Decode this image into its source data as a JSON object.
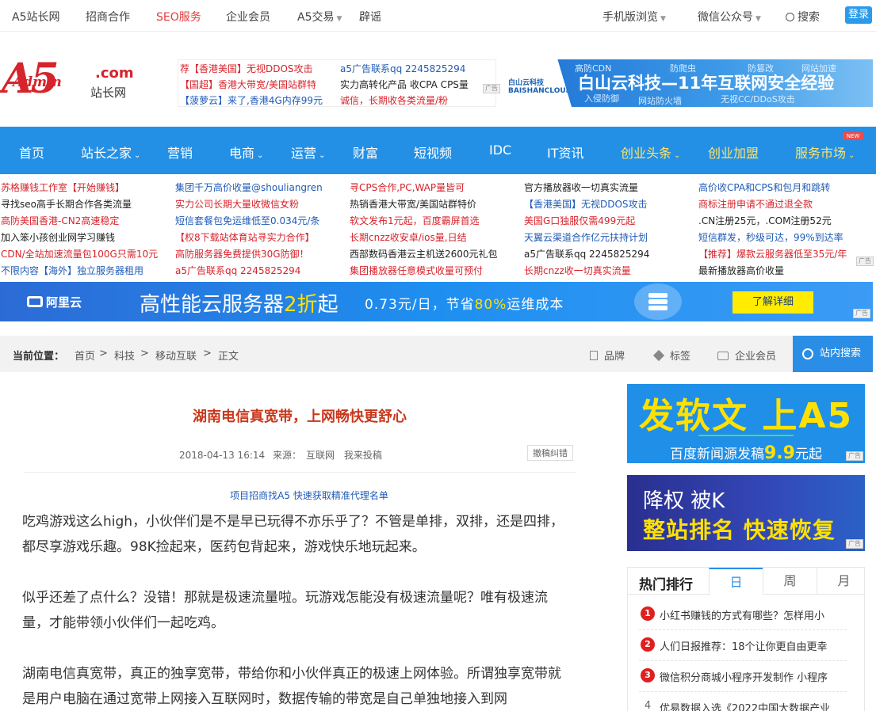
{
  "topbar": {
    "items": [
      "A5站长网",
      "招商合作",
      "SEO服务",
      "企业会员",
      "A5交易",
      "辟谣"
    ],
    "right": [
      "手机版浏览",
      "微信公众号",
      "搜索"
    ],
    "login": "登录"
  },
  "logo": {
    "mark": "A5",
    "sub": "Admin",
    "com": ".com",
    "site": "站长网"
  },
  "text_ads": [
    [
      "荐【香港美国】无视DDOS攻击",
      "a5广告联系qq 2245825294"
    ],
    [
      "【国超】香港大带宽/美国站群特",
      "实力高转化产品 收CPA CPS量"
    ],
    [
      "【菠萝云】来了,香港4G内存99元",
      "诚信，长期收各类流量/粉"
    ]
  ],
  "baishan": {
    "logo": "白山云科技 BAISHANCLOUD",
    "headline": "白山云科技—11年互联网安全经验",
    "tags": [
      "高防CDN",
      "防爬虫",
      "防篡改",
      "网站加速",
      "入侵防御",
      "网站防火墙",
      "无视CC/DDoS攻击"
    ]
  },
  "nav": {
    "items": [
      "首页",
      "站长之家",
      "营销",
      "电商",
      "运营",
      "财富",
      "短视频",
      "IDC",
      "IT资讯",
      "创业头条",
      "创业加盟",
      "服务市场"
    ],
    "badge": "NEW"
  },
  "links": {
    "col1": [
      "苏格赚钱工作室【开始赚钱】",
      "寻找seo高手长期合作各类流量",
      "高防美国香港-CN2高速稳定",
      "加入笨小孩创业网学习赚钱",
      "CDN/全站加速流量包100G只需10元",
      "不限内容【海外】独立服务器租用"
    ],
    "col2": [
      "集团千万高价收量@shouliangren",
      "实力公司长期大量收微信女粉",
      "短信套餐包免运维低至0.034元/条",
      "【权8下载站体育站寻实力合作】",
      "高防服务器免费提供30G防御！",
      "a5广告联系qq 2245825294"
    ],
    "col3": [
      "寻CPS合作,PC,WAP量皆可",
      "热销香港大带宽/美国站群特价",
      "软文发布1元起，百度霸屏首选",
      "长期cnzz收安卓/ios量,日结",
      "西部数码香港云主机送2600元礼包",
      "集团播放器任意模式收量可预付"
    ],
    "col4": [
      "官方播放器收一切真实流量",
      "【香港美国】无视DDOS攻击",
      "美国G口独服仅需499元起",
      "天翼云渠道合作亿元扶持计划",
      "a5广告联系qq 2245825294",
      "长期cnzz收一切真实流量"
    ],
    "col5": [
      "高价收CPA和CPS和包月和跳转",
      "商标注册申请不通过退全款",
      ".CN注册25元，.COM注册52元",
      "短信群发，秒级可达，99%到达率",
      "【推荐】爆款云服务器低至35元/年",
      "最新播放器高价收量"
    ]
  },
  "aliyun": {
    "brand": "阿里云",
    "headline_a": "高性能云服务器",
    "headline_b": "2折",
    "headline_c": "起",
    "sub_a": "0.73元/日，节省",
    "sub_b": "80%",
    "sub_c": "运维成本",
    "cta": "了解详细"
  },
  "breadcrumb": {
    "label": "当前位置：",
    "path": [
      "首页",
      ">",
      "科技",
      ">",
      "移动互联",
      ">",
      "正文"
    ],
    "tools": [
      "品牌",
      "标签",
      "企业会员"
    ],
    "search": "站内搜索"
  },
  "article": {
    "title": "湖南电信真宽带，上网畅快更舒心",
    "date": "2018-04-13 16:14",
    "source_label": "来源：",
    "source": "互联网",
    "submit": "我来投稿",
    "correction": "撤稿纠错",
    "promo": "项目招商找A5 快速获取精准代理名单",
    "paragraphs": [
      "吃鸡游戏这么high，小伙伴们是不是早已玩得不亦乐乎了？不管是单排，双排，还是四排，都尽享游戏乐趣。98K捡起来，医药包背起来，游戏快乐地玩起来。",
      "似乎还差了点什么？没错！那就是极速流量啦。玩游戏怎能没有极速流量呢？唯有极速流量，才能带领小伙伴们一起吃鸡。",
      "湖南电信真宽带，真正的独享宽带，带给你和小伙伴真正的极速上网体验。所谓独享宽带就是用户电脑在通过宽带上网接入互联网时，数据传输的带宽是自己单独地接入到网"
    ]
  },
  "side_ads": {
    "ad1_main": "发软文 上A5",
    "ad1_sub_a": "百度新闻源发稿",
    "ad1_sub_b": "9.9",
    "ad1_sub_c": "元起",
    "ad2_l1": "降权 被K",
    "ad2_l2": "整站排名 快速恢复",
    "ad_tag": "广告"
  },
  "hot": {
    "title": "热门排行",
    "tabs": [
      "日",
      "周",
      "月"
    ],
    "items": [
      {
        "n": "1",
        "text": "小红书赚钱的方式有哪些？怎样用小"
      },
      {
        "n": "2",
        "text": "人们日报推荐：18个让你更自由更幸"
      },
      {
        "n": "3",
        "text": "微信积分商城小程序开发制作 小程序"
      },
      {
        "n": "4",
        "text": "优易数据入选《2022中国大数据产业"
      }
    ]
  }
}
